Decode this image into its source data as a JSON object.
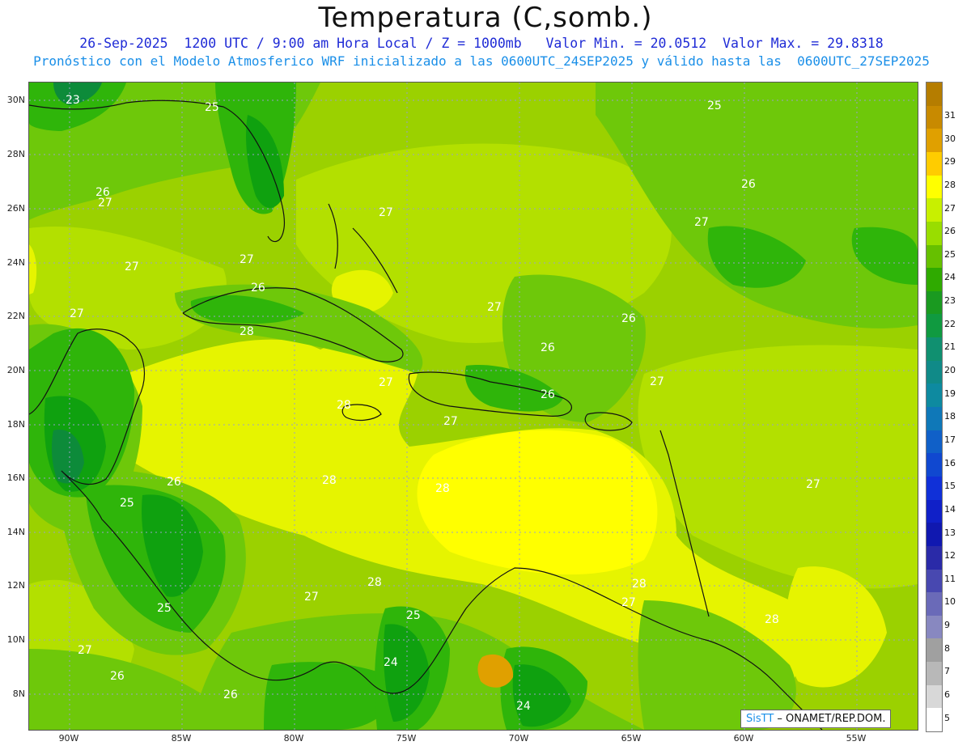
{
  "header": {
    "title": "Temperatura (C,somb.)",
    "line1": "26-Sep-2025  1200 UTC / 9:00 am Hora Local / Z = 1000mb   Valor Min. = 20.0512  Valor Max. = 29.8318",
    "line2": "Pronóstico con el Modelo Atmosferico WRF inicializado a las 0600UTC_24SEP2025 y válido hasta las  0600UTC_27SEP2025"
  },
  "map": {
    "lat_labels": [
      "30N",
      "28N",
      "26N",
      "24N",
      "22N",
      "20N",
      "18N",
      "16N",
      "14N",
      "12N",
      "10N",
      "8N"
    ],
    "lon_labels": [
      "90W",
      "85W",
      "80W",
      "75W",
      "70W",
      "65W",
      "60W",
      "55W"
    ],
    "contour_labels": [
      "23",
      "25",
      "25",
      "26",
      "27",
      "27",
      "27",
      "27",
      "26",
      "28",
      "27",
      "28",
      "27",
      "27",
      "26",
      "26",
      "27",
      "26",
      "27",
      "25",
      "28",
      "28",
      "26",
      "27",
      "28",
      "27",
      "28",
      "25",
      "27",
      "28",
      "24",
      "24",
      "26",
      "26",
      "27",
      "25",
      "26",
      "27"
    ],
    "colors": {
      "c24": "#0fa10f",
      "c25": "#2fb50a",
      "c26": "#6ec80a",
      "c27": "#9bd100",
      "c27b": "#b3e000",
      "c28": "#e6f400",
      "c28b": "#ffff00",
      "c22": "#0d8b3a",
      "c21": "#118a6a"
    }
  },
  "colorbar": {
    "ticks": [
      "31",
      "30",
      "29",
      "28",
      "27",
      "26",
      "25",
      "24",
      "23",
      "22",
      "21",
      "20",
      "19",
      "18",
      "17",
      "16",
      "15",
      "14",
      "13",
      "12",
      "11",
      "10",
      "9",
      "8",
      "7",
      "6",
      "5"
    ],
    "colors": [
      "#c88a00",
      "#e0a000",
      "#ffcc00",
      "#ffff00",
      "#c8f000",
      "#99dd00",
      "#66c000",
      "#2faa00",
      "#1a9a20",
      "#109a40",
      "#109070",
      "#108a88",
      "#0e8aa0",
      "#0f78b8",
      "#1060c8",
      "#1048d0",
      "#1030d8",
      "#1020c8",
      "#1018b0",
      "#2a2aa8",
      "#4848b0",
      "#6a6ab8",
      "#8888c0",
      "#a0a0a0",
      "#b8b8b8",
      "#d8d8d8",
      "#ffffff"
    ]
  },
  "credit": {
    "logo": "SisTT",
    "text": " – ONAMET/REP.DOM."
  }
}
